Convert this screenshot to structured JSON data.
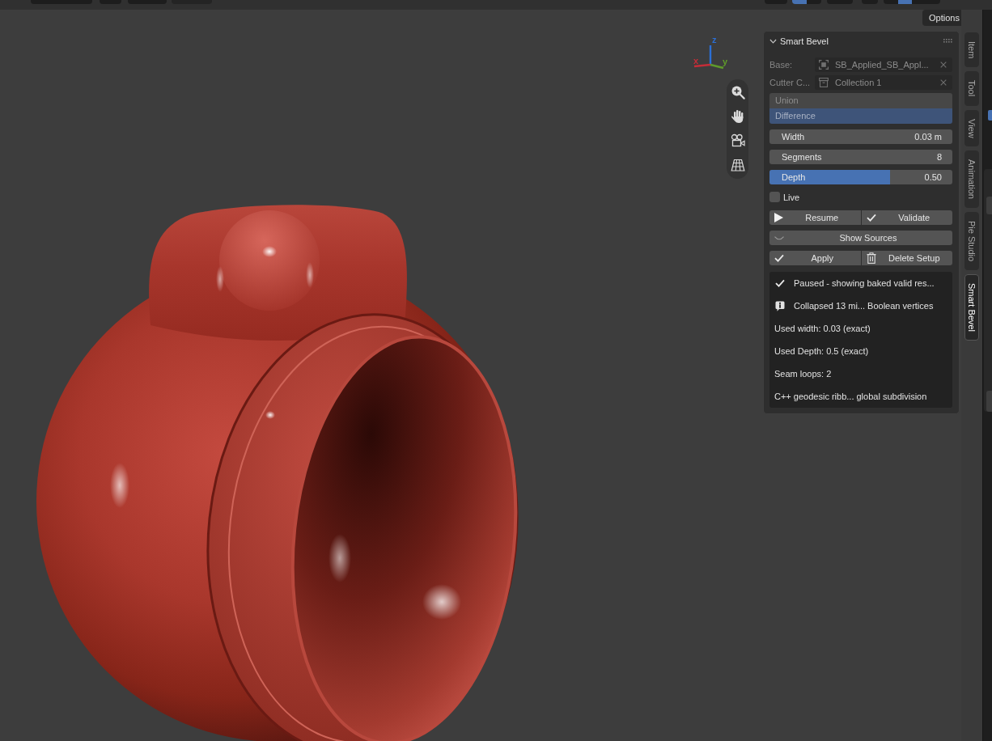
{
  "viewport": {
    "options_button": {
      "label": "Options"
    },
    "gizmo_axes": [
      {
        "label": "z",
        "color": "#2b6fd6"
      },
      {
        "label": "x",
        "color": "#c42d38"
      },
      {
        "label": "y",
        "color": "#5f9a2b"
      }
    ]
  },
  "panel": {
    "title": "Smart Bevel",
    "expanded": true,
    "fields": [
      {
        "label": "Base:",
        "value": "SB_Applied_SB_Appl...",
        "kind": "object",
        "disabled": true
      },
      {
        "label": "Cutter C...",
        "value": "Collection 1",
        "kind": "collection",
        "disabled": true
      }
    ],
    "operation": {
      "disabled": true,
      "options": [
        {
          "label": "Union",
          "selected": false
        },
        {
          "label": "Difference",
          "selected": true
        }
      ]
    },
    "properties": [
      {
        "label": "Width",
        "value": "0.03 m",
        "kind": "number"
      },
      {
        "label": "Segments",
        "value": "8",
        "kind": "number"
      },
      {
        "label": "Depth",
        "value": "0.50",
        "kind": "slider",
        "level": 0.66
      }
    ],
    "live": {
      "label": "Live",
      "checked": false
    },
    "button_rows": [
      {
        "buttons": [
          {
            "label": "Resume",
            "kind": "play"
          },
          {
            "label": "Validate",
            "kind": "check"
          }
        ]
      },
      {
        "buttons": [
          {
            "label": "Show Sources",
            "kind": "reveal"
          }
        ]
      },
      {
        "buttons": [
          {
            "label": "Apply",
            "kind": "check"
          },
          {
            "label": "Delete Setup",
            "kind": "delete"
          }
        ]
      }
    ],
    "report": [
      {
        "text": "Paused - showing baked valid res...",
        "kind": "success"
      },
      {
        "text": "Collapsed 13 mi... Boolean vertices",
        "kind": "info"
      },
      {
        "text": "Used width: 0.03 (exact)",
        "kind": "plain"
      },
      {
        "text": "Used Depth: 0.5 (exact)",
        "kind": "plain"
      },
      {
        "text": "Seam loops: 2",
        "kind": "plain"
      },
      {
        "text": "C++ geodesic ribb... global subdivision",
        "kind": "plain"
      }
    ]
  },
  "sidebar_tabs": [
    {
      "label": "Item",
      "selected": false
    },
    {
      "label": "Tool",
      "selected": false
    },
    {
      "label": "View",
      "selected": false
    },
    {
      "label": "Animation",
      "selected": false
    },
    {
      "label": "Pie Studio",
      "selected": false
    },
    {
      "label": "Smart Bevel",
      "selected": true
    }
  ]
}
